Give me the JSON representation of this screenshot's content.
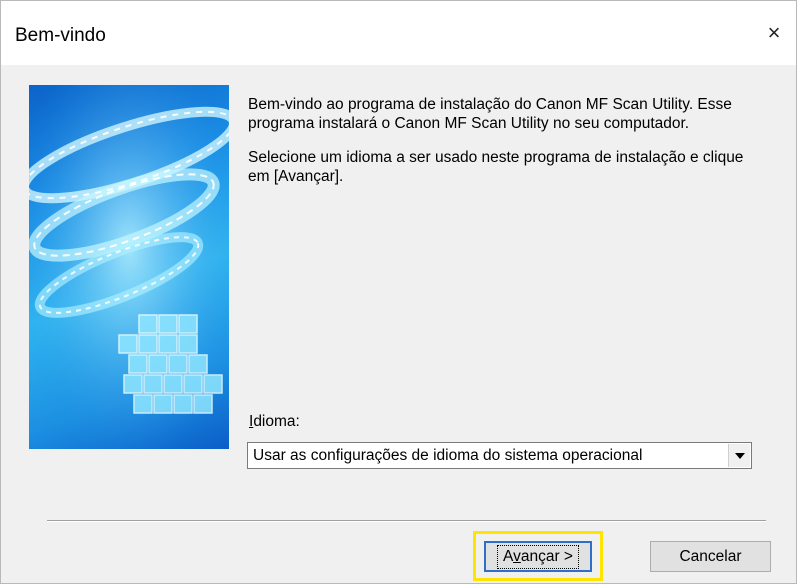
{
  "window": {
    "title": "Bem-vindo",
    "close_symbol": "×"
  },
  "intro": {
    "paragraph1": "Bem-vindo ao programa de instalação do Canon MF Scan Utility. Esse programa instalará o Canon MF Scan Utility no seu computador.",
    "paragraph2": "Selecione um idioma a ser usado neste programa de instalação e clique em [Avançar]."
  },
  "language": {
    "label_mnemonic": "I",
    "label_rest": "dioma:",
    "selected": "Usar as configurações de idioma do sistema operacional"
  },
  "buttons": {
    "next_pre": "A",
    "next_mnemonic": "v",
    "next_post": "ançar >",
    "cancel": "Cancelar"
  },
  "colors": {
    "highlight": "#ffe400",
    "dialog_bg": "#f0f0f0",
    "default_button_border": "#2f6fc7"
  },
  "icons": {
    "close": "close-icon",
    "dropdown": "chevron-down-icon",
    "banner": "installer-banner-image"
  }
}
